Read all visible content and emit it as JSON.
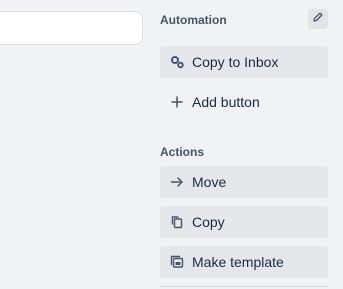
{
  "automation": {
    "title": "Automation",
    "edit_icon": "pencil-icon",
    "buttons": [
      {
        "label": "Copy to Inbox",
        "icon": "gears-icon"
      },
      {
        "label": "Add button",
        "icon": "plus-icon"
      }
    ]
  },
  "actions": {
    "title": "Actions",
    "buttons": [
      {
        "label": "Move",
        "icon": "arrow-right-icon"
      },
      {
        "label": "Copy",
        "icon": "copy-icon"
      },
      {
        "label": "Make template",
        "icon": "template-icon"
      }
    ]
  }
}
